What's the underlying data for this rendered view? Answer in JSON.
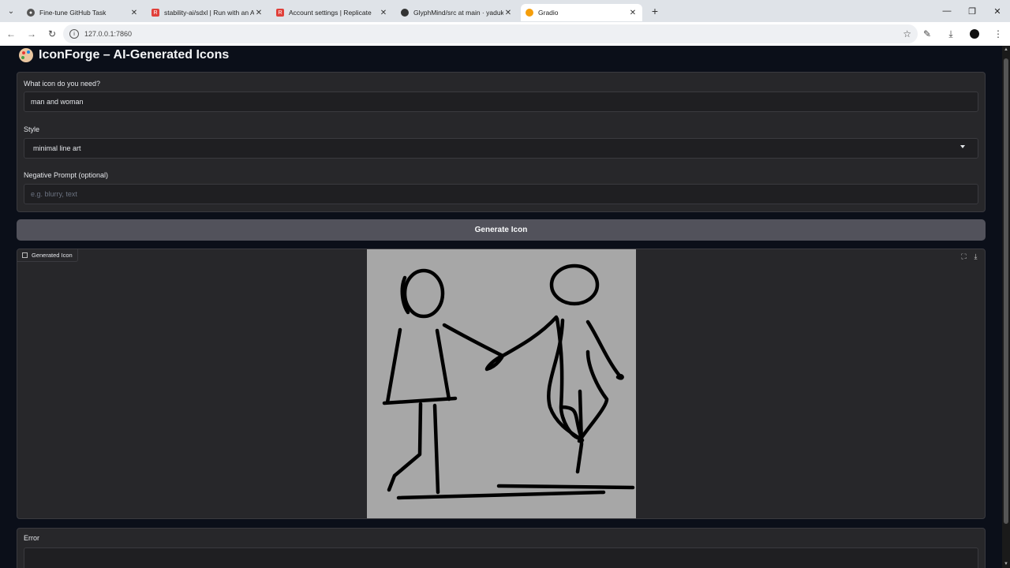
{
  "browser": {
    "tabs": [
      {
        "title": "Fine-tune GitHub Task",
        "favicon": "chatgpt-icon",
        "color": "#555555"
      },
      {
        "title": "stability-ai/sdxl | Run with an API",
        "favicon": "replicate-icon",
        "color": "#e0403a"
      },
      {
        "title": "Account settings | Replicate",
        "favicon": "replicate-icon",
        "color": "#e0403a"
      },
      {
        "title": "GlyphMind/src at main · yaduk",
        "favicon": "github-icon",
        "color": "#333333"
      },
      {
        "title": "Gradio",
        "favicon": "gradio-icon",
        "color": "#f59e0b"
      }
    ],
    "active_tab": 4,
    "url": "127.0.0.1:7860"
  },
  "app": {
    "title": "IconForge – AI-Generated Icons",
    "prompt_label": "What icon do you need?",
    "prompt_value": "man and woman",
    "style_label": "Style",
    "style_value": "minimal line art",
    "negative_label": "Negative Prompt (optional)",
    "negative_placeholder": "e.g. blurry, text",
    "generate_label": "Generate Icon",
    "image_label": "Generated Icon",
    "error_label": "Error"
  }
}
